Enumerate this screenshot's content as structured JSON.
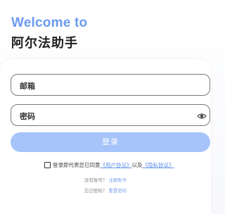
{
  "header": {
    "welcome": "Welcome to",
    "app_name": "阿尔法助手"
  },
  "form": {
    "email_placeholder": "邮箱",
    "password_placeholder": "密码",
    "login_label": "登录"
  },
  "agreement": {
    "prefix": "登录即代表您已同意",
    "user_agreement": "《用户协议》",
    "joiner": "以及",
    "privacy_policy": "《隐私协议》"
  },
  "links": {
    "no_account": "没有账号？",
    "register": "注册账号",
    "forgot_password": "忘记密码？",
    "reset_password": "重置密码"
  },
  "colors": {
    "accent": "#6c9cf0",
    "button": "#a6c4fa",
    "link": "#5f8fe8"
  },
  "icons": {
    "password_visibility": "eye-icon"
  }
}
